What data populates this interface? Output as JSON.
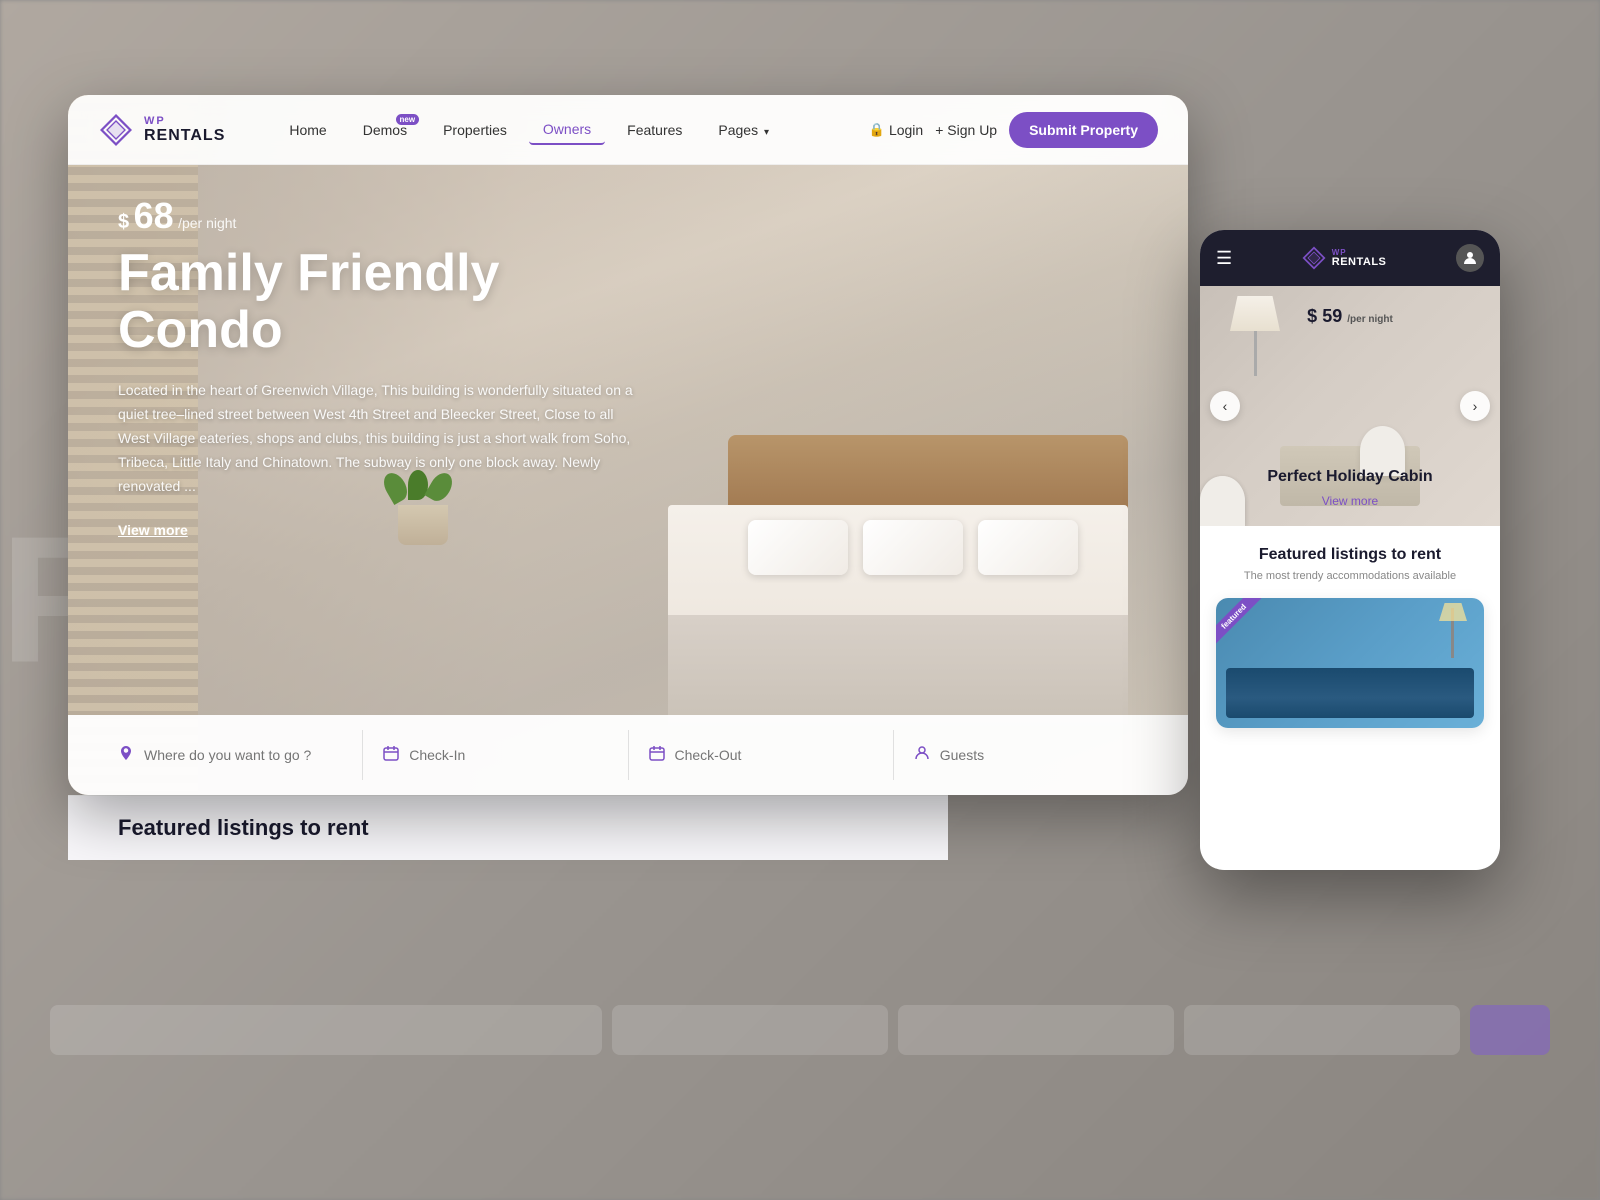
{
  "background": {
    "text": "Family Friendly Condo"
  },
  "desktop_card": {
    "navbar": {
      "logo": {
        "wp": "WP",
        "rentals": "RENTALS"
      },
      "nav_items": [
        {
          "label": "Home",
          "active": false,
          "badge": null
        },
        {
          "label": "Demos",
          "active": false,
          "badge": "new"
        },
        {
          "label": "Properties",
          "active": false,
          "badge": null
        },
        {
          "label": "Owners",
          "active": true,
          "badge": null
        },
        {
          "label": "Features",
          "active": false,
          "badge": null
        },
        {
          "label": "Pages",
          "active": false,
          "badge": null
        }
      ],
      "login": "Login",
      "signup": "+ Sign Up",
      "submit_property": "Submit Property"
    },
    "hero": {
      "price": {
        "currency": "$",
        "amount": "68",
        "per": "/per night"
      },
      "title": "Family Friendly Condo",
      "description": "Located in the heart of Greenwich Village, This building is wonderfully situated on a quiet tree–lined street between West 4th Street and Bleecker Street, Close to all West Village eateries, shops and clubs, this building is just a short walk from Soho, Tribeca, Little Italy and Chinatown. The subway is only one block away. Newly renovated ...",
      "view_more": "View more"
    },
    "search": {
      "location_placeholder": "Where do you want to go ?",
      "checkin_placeholder": "Check-In",
      "checkout_placeholder": "Check-Out",
      "guests_placeholder": "Guests"
    },
    "bottom_bar": {
      "title": "Featured listings to rent"
    }
  },
  "mobile_card": {
    "navbar": {
      "logo": {
        "wp": "WP",
        "rentals": "RENTALS"
      },
      "menu_icon": "☰",
      "avatar_icon": "👤"
    },
    "hero": {
      "price": {
        "currency": "$",
        "amount": "59",
        "per": "/per night"
      },
      "title": "Perfect Holiday Cabin",
      "view_more": "View more",
      "prev": "‹",
      "next": "›"
    },
    "featured_section": {
      "title": "Featured listings to rent",
      "subtitle": "The most trendy accommodations available",
      "badge": "featured"
    }
  }
}
